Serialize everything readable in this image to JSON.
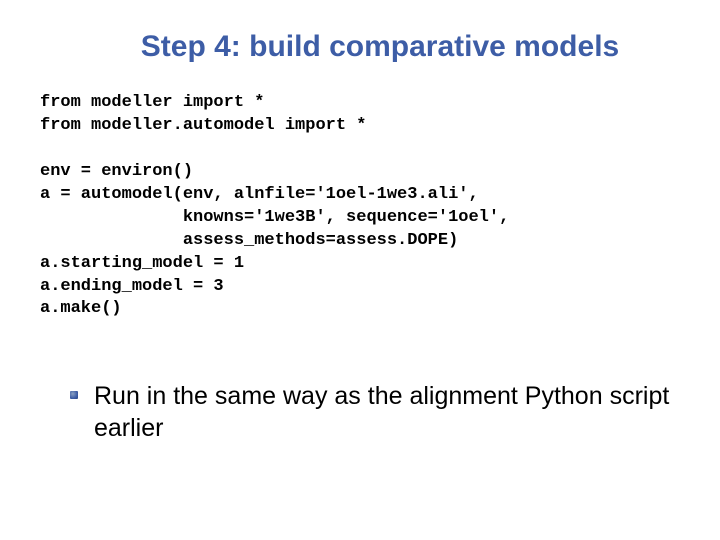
{
  "title": "Step 4: build comparative models",
  "code": "from modeller import *\nfrom modeller.automodel import *\n\nenv = environ()\na = automodel(env, alnfile='1oel-1we3.ali',\n              knowns='1we3B', sequence='1oel',\n              assess_methods=assess.DOPE)\na.starting_model = 1\na.ending_model = 3\na.make()",
  "bullets": [
    "Run in the same way as the alignment Python script earlier"
  ]
}
